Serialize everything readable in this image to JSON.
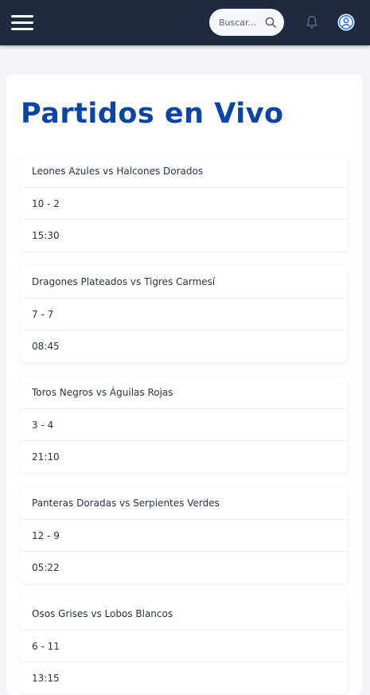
{
  "header": {
    "search_placeholder": "Buscar..."
  },
  "page": {
    "title": "Partidos en Vivo"
  },
  "matches": [
    {
      "teams": "Leones Azules vs Halcones Dorados",
      "score": "10 - 2",
      "time": "15:30"
    },
    {
      "teams": "Dragones Plateados vs Tigres Carmesí",
      "score": "7 - 7",
      "time": "08:45"
    },
    {
      "teams": "Toros Negros vs Águilas Rojas",
      "score": "3 - 4",
      "time": "21:10"
    },
    {
      "teams": "Panteras Doradas vs Serpientes Verdes",
      "score": "12 - 9",
      "time": "05:22"
    },
    {
      "teams": "Osos Grises vs Lobos Blancos",
      "score": "6 - 11",
      "time": "13:15"
    }
  ],
  "colors": {
    "header_bg": "#1f2a40",
    "title": "#0c44a6",
    "page_bg": "#f3f4f7",
    "avatar_accent": "#2f7be0"
  },
  "icons": {
    "menu": "hamburger-icon",
    "search": "search-icon",
    "notifications": "bell-icon",
    "account": "user-circle-icon"
  }
}
